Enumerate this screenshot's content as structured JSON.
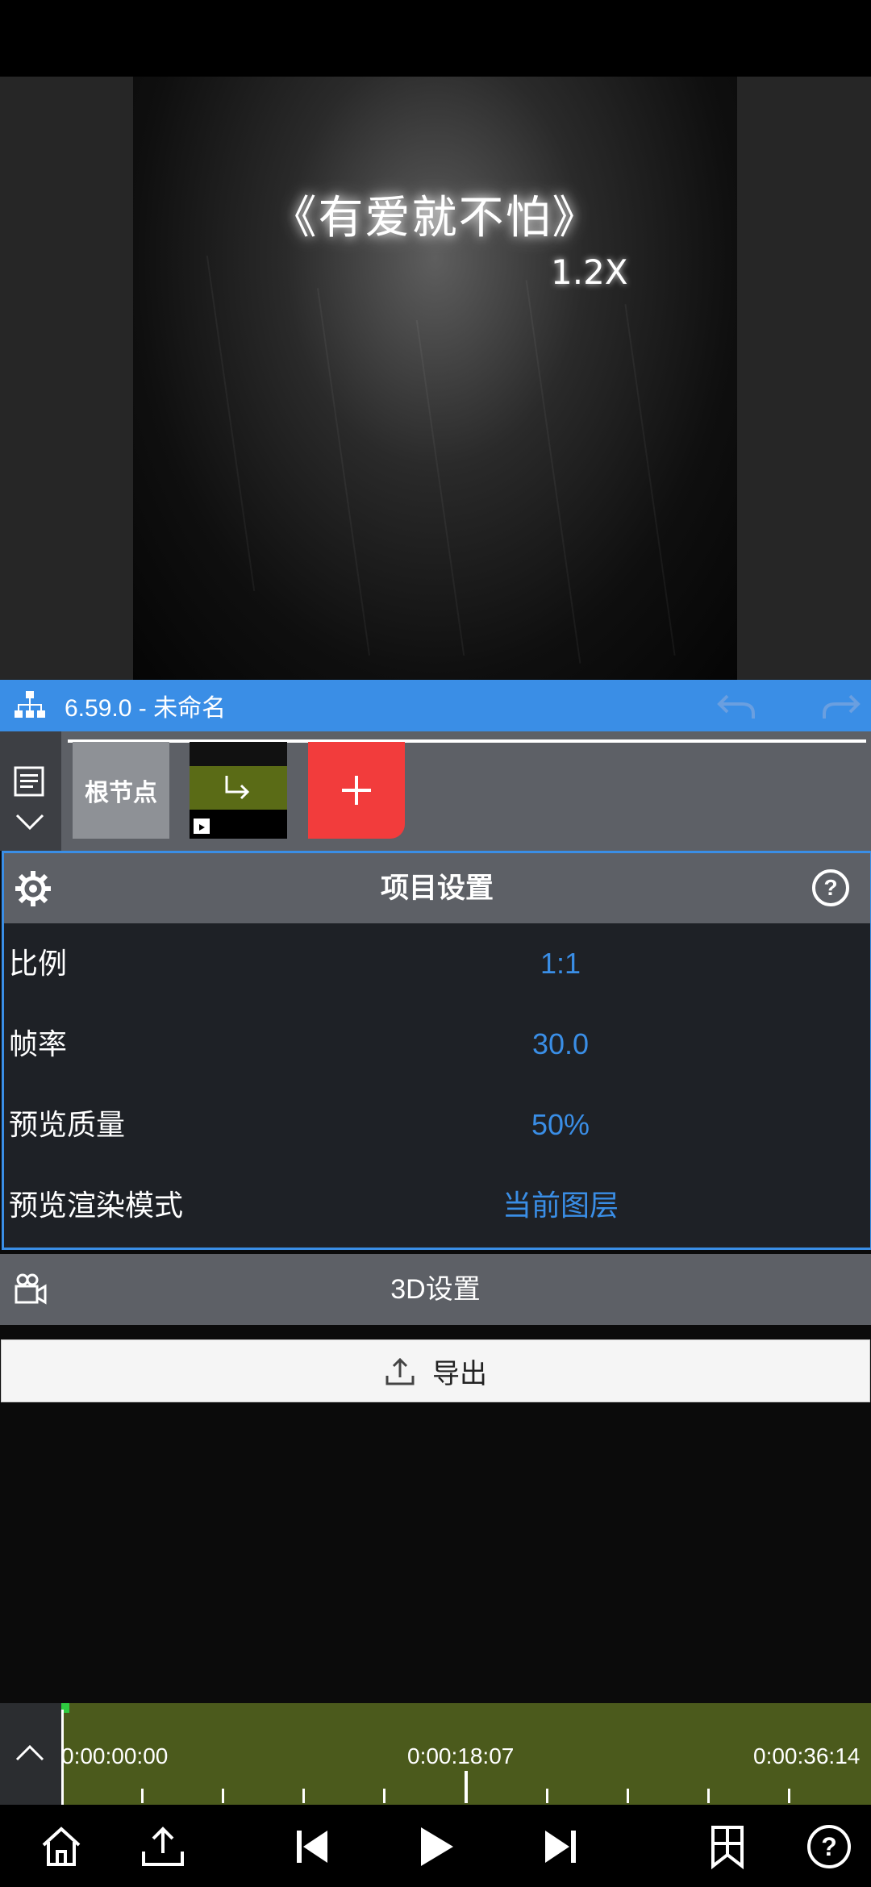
{
  "preview": {
    "title_text": "《有爱就不怕》",
    "speed_text": "1.2X"
  },
  "project_bar": {
    "title": "6.59.0 - 未命名"
  },
  "nodes": {
    "root_label": "根节点"
  },
  "project_settings": {
    "title": "项目设置",
    "rows": [
      {
        "label": "比例",
        "value": "1:1"
      },
      {
        "label": "帧率",
        "value": "30.0"
      },
      {
        "label": "预览质量",
        "value": "50%"
      },
      {
        "label": "预览渲染模式",
        "value": "当前图层"
      }
    ]
  },
  "three_d": {
    "title": "3D设置"
  },
  "export": {
    "label": "导出"
  },
  "timeline": {
    "times": [
      "0:00:00:00",
      "0:00:18:07",
      "0:00:36:14"
    ]
  },
  "colors": {
    "accent": "#3a8ee6",
    "add_button": "#f23c3c",
    "track": "#4b5a1c"
  }
}
